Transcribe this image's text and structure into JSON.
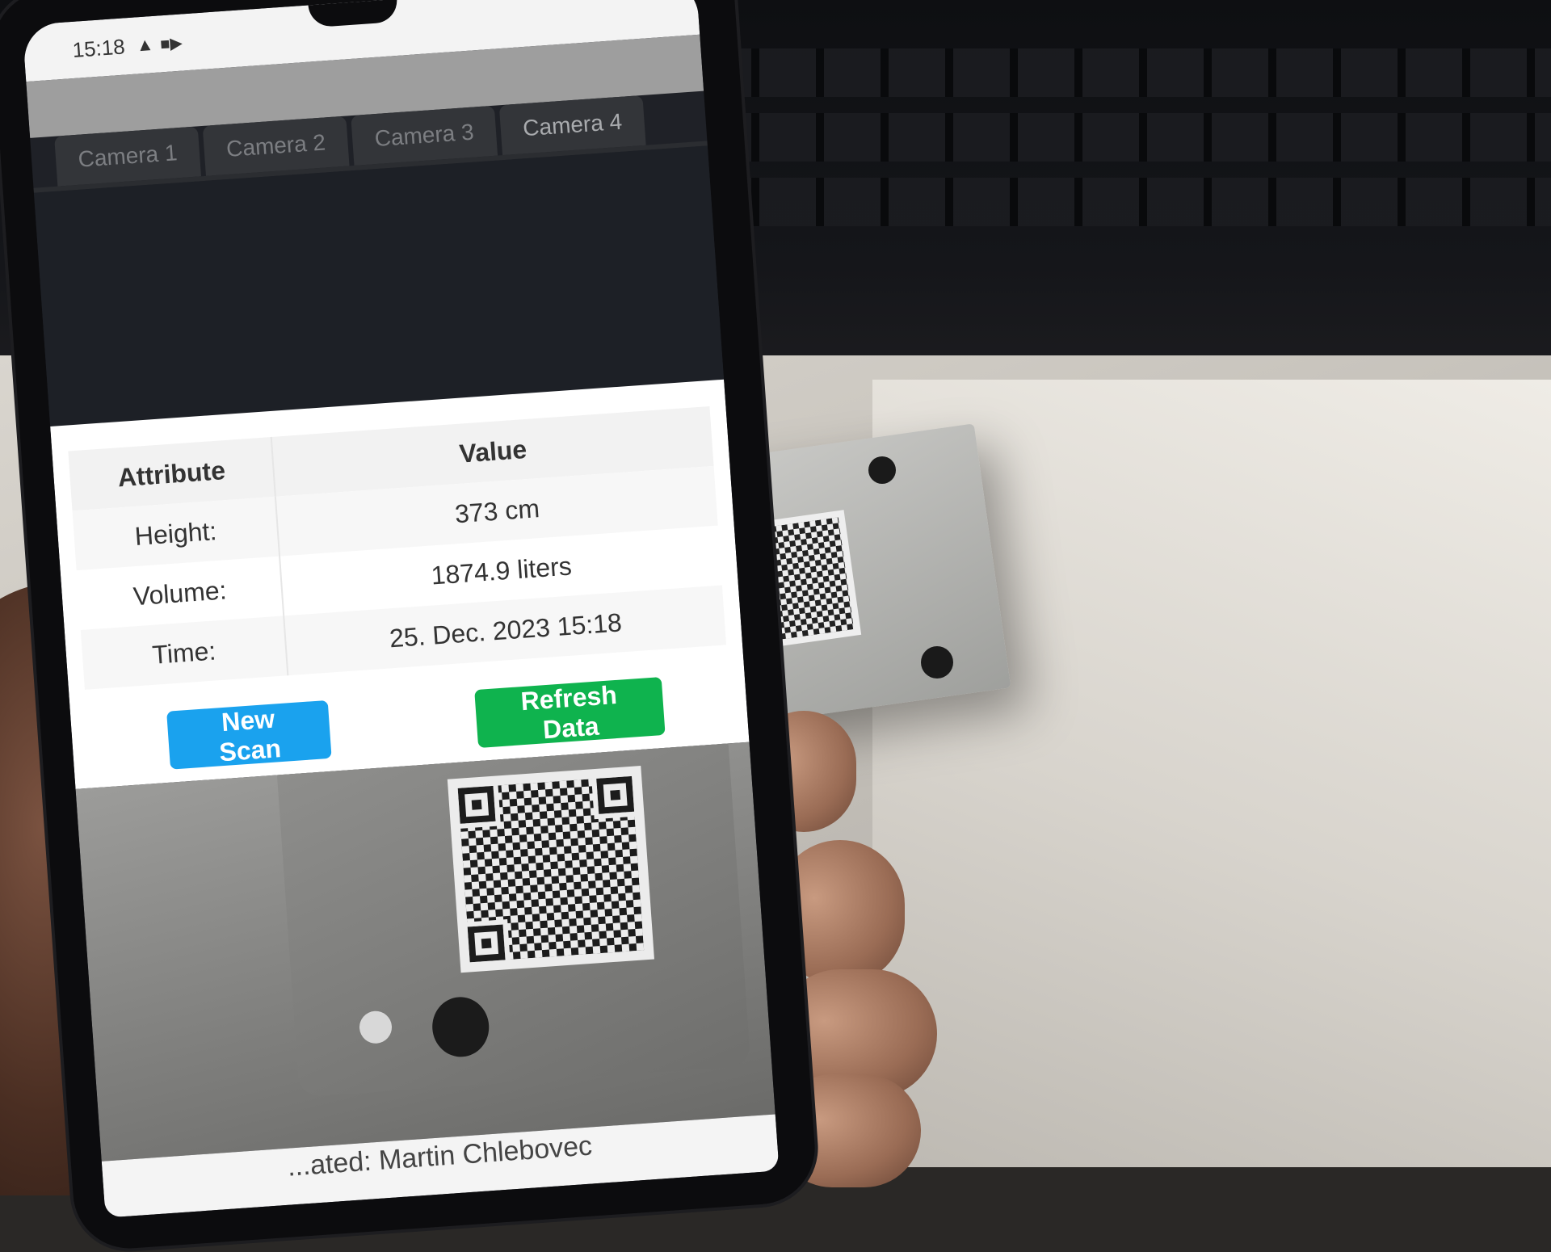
{
  "status_bar": {
    "time": "15:18"
  },
  "tabs": [
    "Camera 1",
    "Camera 2",
    "Camera 3",
    "Camera 4"
  ],
  "table": {
    "headers": [
      "Attribute",
      "Value"
    ],
    "rows": [
      {
        "attribute": "Height:",
        "value": "373 cm"
      },
      {
        "attribute": "Volume:",
        "value": "1874.9 liters"
      },
      {
        "attribute": "Time:",
        "value": "25. Dec. 2023 15:18"
      }
    ]
  },
  "buttons": {
    "new_scan": "New Scan",
    "refresh": "Refresh Data"
  },
  "footer": {
    "text": "...ated: Martin Chlebovec"
  },
  "colors": {
    "blue_button": "#1aa2ee",
    "green_button": "#0fb34e"
  }
}
